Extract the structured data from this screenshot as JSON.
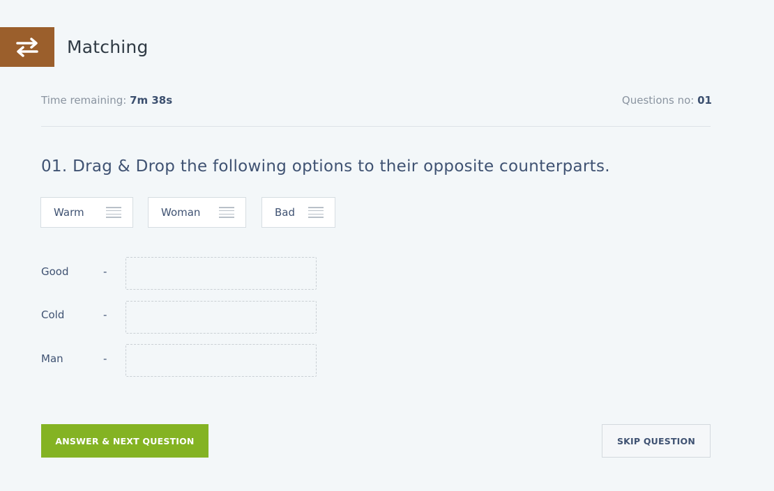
{
  "header": {
    "title": "Matching",
    "icon": "swap-arrows-icon",
    "badge_color": "#9b5f2c"
  },
  "meta": {
    "time_label": "Time remaining:",
    "time_value": "7m 38s",
    "questions_label": "Questions no:",
    "questions_value": "01"
  },
  "question": {
    "text": "01. Drag & Drop the following options to their opposite counterparts."
  },
  "options": [
    {
      "label": "Warm",
      "icon": "drag-handle-icon"
    },
    {
      "label": "Woman",
      "icon": "drag-handle-icon"
    },
    {
      "label": "Bad",
      "icon": "drag-handle-icon"
    }
  ],
  "pairs": [
    {
      "label": "Good",
      "separator": "-",
      "answer": ""
    },
    {
      "label": "Cold",
      "separator": "-",
      "answer": ""
    },
    {
      "label": "Man",
      "separator": "-",
      "answer": ""
    }
  ],
  "actions": {
    "answer_next_label": "ANSWER & NEXT QUESTION",
    "skip_label": "SKIP QUESTION",
    "primary_color": "#84b323"
  }
}
